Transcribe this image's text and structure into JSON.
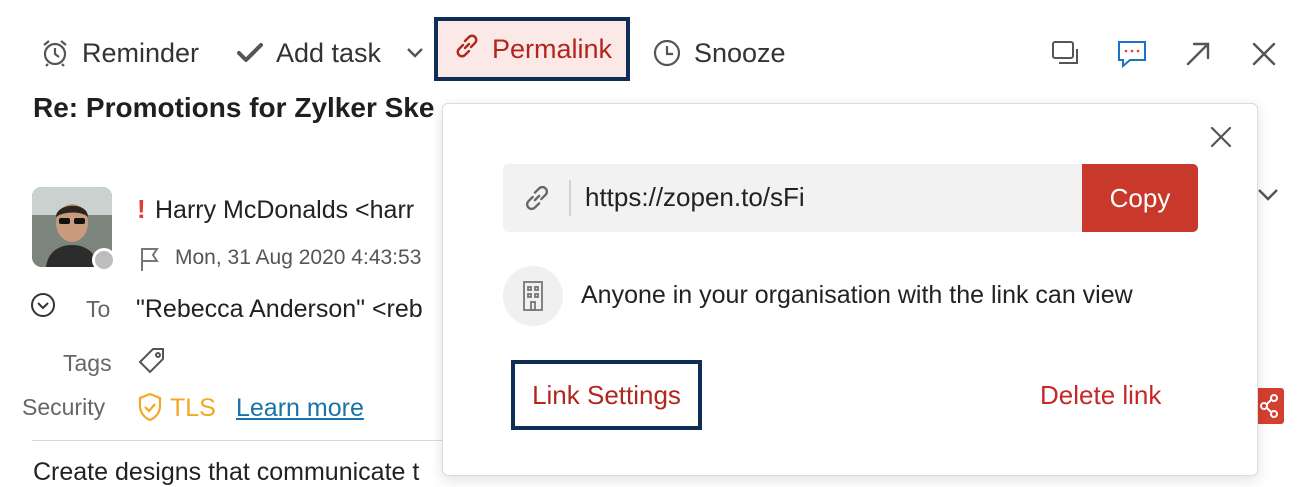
{
  "toolbar": {
    "reminder_label": "Reminder",
    "add_task_label": "Add task",
    "permalink_label": "Permalink",
    "snooze_label": "Snooze",
    "icons": [
      "alarm-clock-icon",
      "checkmark-icon",
      "chevron-down-icon",
      "link-icon",
      "clock-icon",
      "windows-icon",
      "chat-icon",
      "expand-icon",
      "close-icon"
    ]
  },
  "email": {
    "subject": "Re: Promotions for Zylker Ske",
    "sender": "Harry McDonalds <harr",
    "importance_mark": "!",
    "date": "Mon, 31 Aug 2020 4:43:53",
    "to_label": "To",
    "to_value": "\"Rebecca Anderson\" <reb",
    "tags_label": "Tags",
    "security_label": "Security",
    "tls_label": "TLS",
    "learn_more_label": "Learn more",
    "body_preview": "Create designs that communicate t"
  },
  "popover": {
    "url": "https://zopen.to/sFi",
    "copy_label": "Copy",
    "permission_text": "Anyone in your organisation with the link can view",
    "link_settings_label": "Link Settings",
    "delete_link_label": "Delete link"
  },
  "colors": {
    "accent_red": "#c8382b",
    "highlight_border": "#0f2d55",
    "permalink_bg": "#fbe9e7",
    "tls_orange": "#f5a623",
    "link_blue": "#1a73a8"
  }
}
